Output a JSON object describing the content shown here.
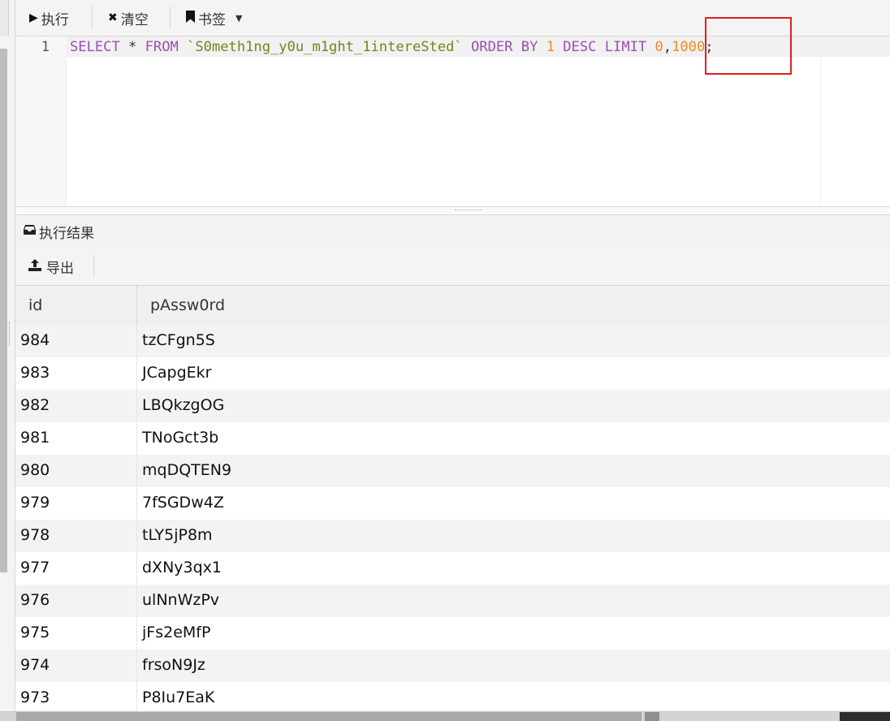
{
  "toolbar": {
    "run_label": "执行",
    "clear_label": "清空",
    "bookmark_label": "书签"
  },
  "editor": {
    "line_number": "1",
    "query": {
      "select": "SELECT",
      "star": " * ",
      "from": "FROM",
      "table": "`S0meth1ng_y0u_m1ght_1intereSted`",
      "order": "ORDER",
      "by": "BY",
      "order_col": "1",
      "desc": "DESC",
      "limit": "LIMIT",
      "offset": "0",
      "comma": ",",
      "count": "1000",
      "end": ";"
    }
  },
  "results": {
    "title": "执行结果",
    "export_label": "导出",
    "columns": [
      "id",
      "pAssw0rd"
    ],
    "rows": [
      {
        "id": "984",
        "password": "tzCFgn5S"
      },
      {
        "id": "983",
        "password": "JCapgEkr"
      },
      {
        "id": "982",
        "password": "LBQkzgOG"
      },
      {
        "id": "981",
        "password": "TNoGct3b"
      },
      {
        "id": "980",
        "password": "mqDQTEN9"
      },
      {
        "id": "979",
        "password": "7fSGDw4Z"
      },
      {
        "id": "978",
        "password": "tLY5jP8m"
      },
      {
        "id": "977",
        "password": "dXNy3qx1"
      },
      {
        "id": "976",
        "password": "ulNnWzPv"
      },
      {
        "id": "975",
        "password": "jFs2eMfP"
      },
      {
        "id": "974",
        "password": "frsoN9Jz"
      },
      {
        "id": "973",
        "password": "P8Iu7EaK"
      }
    ]
  },
  "colors": {
    "keyword": "#9b4fb3",
    "string": "#6c8a19",
    "number": "#f08a1c",
    "highlight": "#e02020"
  }
}
